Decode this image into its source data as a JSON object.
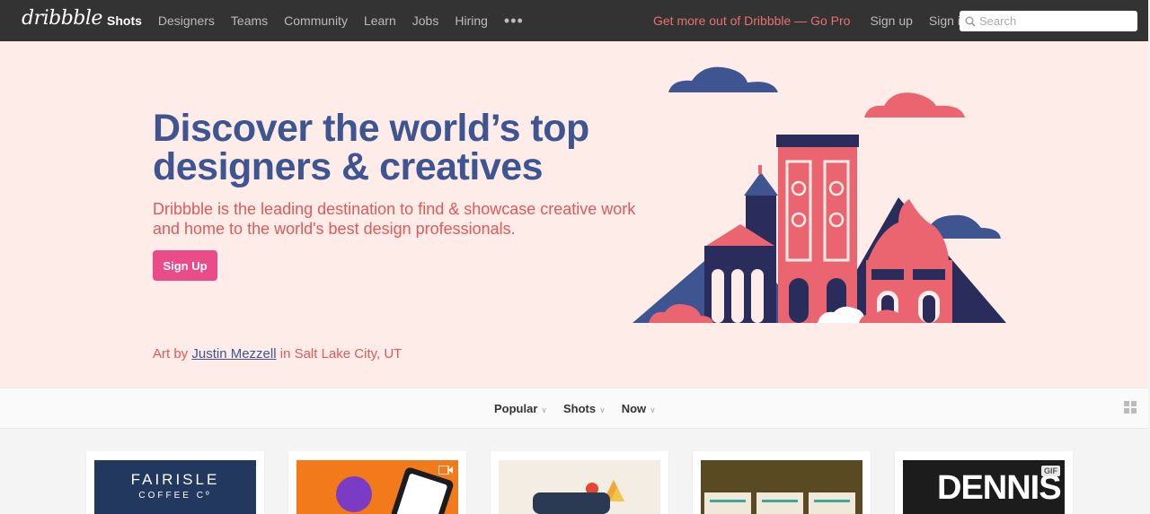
{
  "nav": {
    "logo": "dribbble",
    "links": [
      "Shots",
      "Designers",
      "Teams",
      "Community",
      "Learn",
      "Jobs",
      "Hiring"
    ],
    "more": "•••",
    "gopro": "Get more out of Dribbble — Go Pro",
    "signup": "Sign up",
    "signin": "Sign in",
    "search_placeholder": "Search"
  },
  "hero": {
    "title": "Discover the world’s top designers & creatives",
    "subtitle": "Dribbble is the leading destination to find & showcase creative work and home to the world's best design professionals.",
    "signup_button": "Sign Up",
    "credit_prefix": "Art by ",
    "credit_artist": "Justin Mezzell",
    "credit_suffix": " in Salt Lake City, UT"
  },
  "filters": {
    "items": [
      "Popular",
      "Shots",
      "Now"
    ]
  },
  "shots": {
    "shot1_line1": "FAIRISLE",
    "shot1_line2": "COFFEE Cº",
    "shot5_text": "DENNIS",
    "shot5_badge": "GIF"
  },
  "colors": {
    "nav_bg": "#333333",
    "hero_bg": "#fdece8",
    "title_blue": "#3f5591",
    "accent_red": "#e05a5a",
    "pink": "#ea4c89"
  }
}
